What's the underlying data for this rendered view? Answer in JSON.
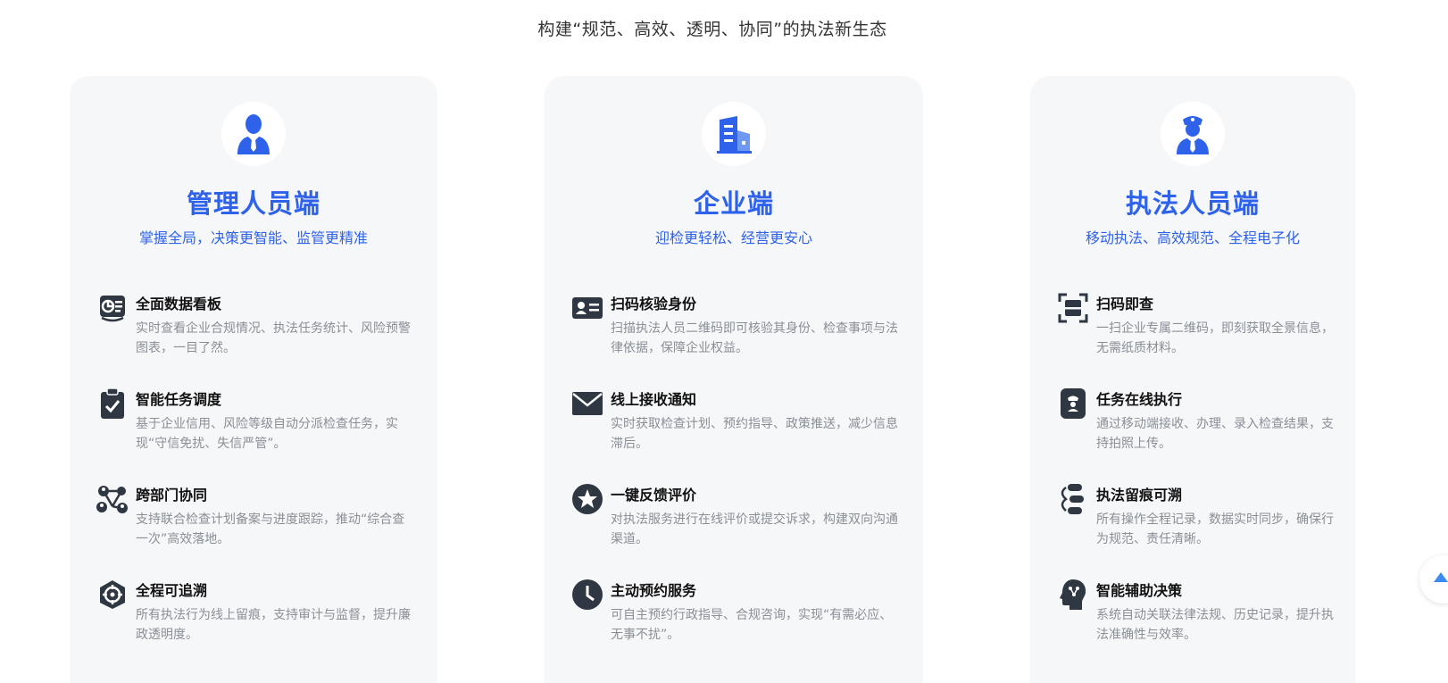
{
  "headline": "构建“规范、高效、透明、协同”的执法新生态",
  "colors": {
    "accent": "#2e62ea",
    "icon_dark": "#2f3742",
    "card_bg": "#f6f7f9"
  },
  "cards": [
    {
      "title": "管理人员端",
      "subtitle": "掌握全局，决策更智能、监管更精准",
      "icon": "manager-person-icon",
      "features": [
        {
          "icon": "dashboard-icon",
          "title": "全面数据看板",
          "desc": "实时查看企业合规情况、执法任务统计、风险预警图表，一目了然。"
        },
        {
          "icon": "clipboard-check-icon",
          "title": "智能任务调度",
          "desc": "基于企业信用、风险等级自动分派检查任务，实现“守信免扰、失信严管”。"
        },
        {
          "icon": "people-network-icon",
          "title": "跨部门协同",
          "desc": "支持联合检查计划备案与进度跟踪，推动“综合查一次”高效落地。"
        },
        {
          "icon": "target-trace-icon",
          "title": "全程可追溯",
          "desc": "所有执法行为线上留痕，支持审计与监督，提升廉政透明度。"
        }
      ]
    },
    {
      "title": "企业端",
      "subtitle": "迎检更轻松、经营更安心",
      "icon": "enterprise-building-icon",
      "features": [
        {
          "icon": "id-card-icon",
          "title": "扫码核验身份",
          "desc": "扫描执法人员二维码即可核验其身份、检查事项与法律依据，保障企业权益。"
        },
        {
          "icon": "envelope-icon",
          "title": "线上接收通知",
          "desc": "实时获取检查计划、预约指导、政策推送，减少信息滞后。"
        },
        {
          "icon": "star-badge-icon",
          "title": "一键反馈评价",
          "desc": "对执法服务进行在线评价或提交诉求，构建双向沟通渠道。"
        },
        {
          "icon": "clock-icon",
          "title": "主动预约服务",
          "desc": "可自主预约行政指导、合规咨询，实现“有需必应、无事不扰”。"
        }
      ]
    },
    {
      "title": "执法人员端",
      "subtitle": "移动执法、高效规范、全程电子化",
      "icon": "officer-icon",
      "features": [
        {
          "icon": "scan-frame-icon",
          "title": "扫码即查",
          "desc": "一扫企业专属二维码，即刻获取全景信息，无需纸质材料。"
        },
        {
          "icon": "mobile-officer-icon",
          "title": "任务在线执行",
          "desc": "通过移动端接收、办理、录入检查结果，支持拍照上传。"
        },
        {
          "icon": "trace-steps-icon",
          "title": "执法留痕可溯",
          "desc": "所有操作全程记录，数据实时同步，确保行为规范、责任清晰。"
        },
        {
          "icon": "ai-brain-head-icon",
          "title": "智能辅助决策",
          "desc": "系统自动关联法律法规、历史记录，提升执法准确性与效率。"
        }
      ]
    }
  ],
  "scroll_top_icon": "arrow-up-icon"
}
